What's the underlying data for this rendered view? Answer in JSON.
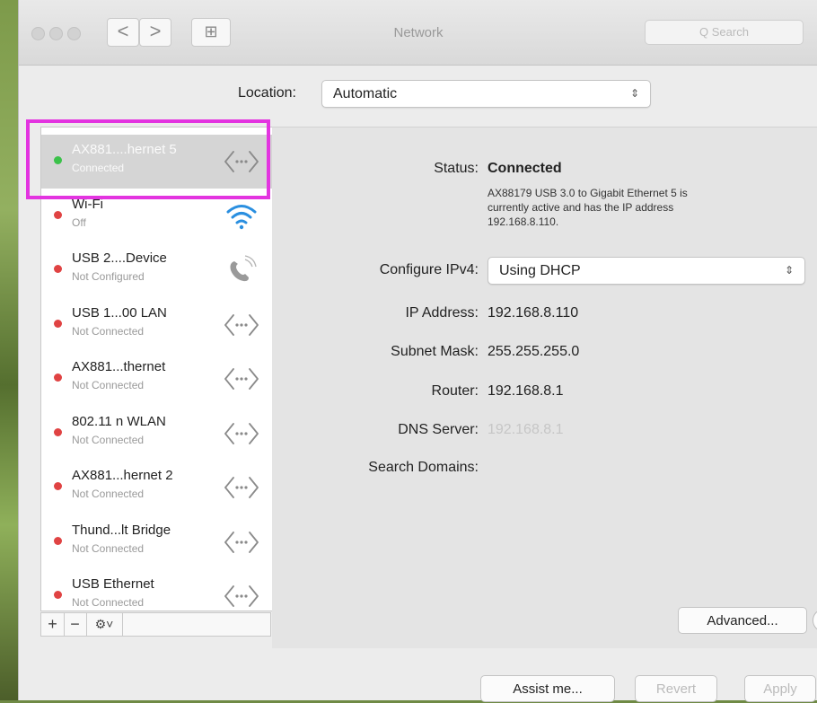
{
  "window": {
    "title": "Network",
    "search_placeholder": "Q Search",
    "back_label": "<",
    "forward_label": ">",
    "grid_label": "⊞"
  },
  "location": {
    "label": "Location:",
    "value": "Automatic"
  },
  "services": [
    {
      "name": "AX881....hernet 5",
      "status": "Connected",
      "dot": "#3bc24a",
      "icon": "ethernet-icon",
      "selected": true
    },
    {
      "name": "Wi-Fi",
      "status": "Off",
      "dot": "#e04343",
      "icon": "wifi-icon"
    },
    {
      "name": "USB 2....Device",
      "status": "Not Configured",
      "dot": "#e04343",
      "icon": "phone-icon"
    },
    {
      "name": "USB 1...00 LAN",
      "status": "Not Connected",
      "dot": "#e04343",
      "icon": "ethernet-icon"
    },
    {
      "name": "AX881...thernet",
      "status": "Not Connected",
      "dot": "#e04343",
      "icon": "ethernet-icon"
    },
    {
      "name": "802.11 n WLAN",
      "status": "Not Connected",
      "dot": "#e04343",
      "icon": "ethernet-icon"
    },
    {
      "name": "AX881...hernet 2",
      "status": "Not Connected",
      "dot": "#e04343",
      "icon": "ethernet-icon"
    },
    {
      "name": "Thund...lt Bridge",
      "status": "Not Connected",
      "dot": "#e04343",
      "icon": "ethernet-icon"
    },
    {
      "name": "USB Ethernet",
      "status": "Not Connected",
      "dot": "#e04343",
      "icon": "ethernet-icon"
    }
  ],
  "toolbar": {
    "add": "+",
    "remove": "−",
    "gear": "⚙˅"
  },
  "details": {
    "status_label": "Status:",
    "status_value": "Connected",
    "status_desc_line1": "AX88179 USB 3.0 to Gigabit Ethernet 5 is",
    "status_desc_line2": "currently active and has the IP address",
    "status_desc_line3": "192.168.8.110.",
    "configure_label": "Configure IPv4:",
    "configure_value": "Using DHCP",
    "ip_label": "IP Address:",
    "ip_value": "192.168.8.110",
    "subnet_label": "Subnet Mask:",
    "subnet_value": "255.255.255.0",
    "router_label": "Router:",
    "router_value": "192.168.8.1",
    "dns_label": "DNS Server:",
    "dns_value": "192.168.8.1",
    "search_domains_label": "Search Domains:",
    "advanced_label": "Advanced...",
    "help_label": "?"
  },
  "footer": {
    "assist_label": "Assist me...",
    "revert_label": "Revert",
    "apply_label": "Apply"
  },
  "colors": {
    "highlight": "#e334e0",
    "connected_dot": "#3bc24a",
    "disconnected_dot": "#e04343",
    "wifi_blue": "#2a8fe0"
  }
}
